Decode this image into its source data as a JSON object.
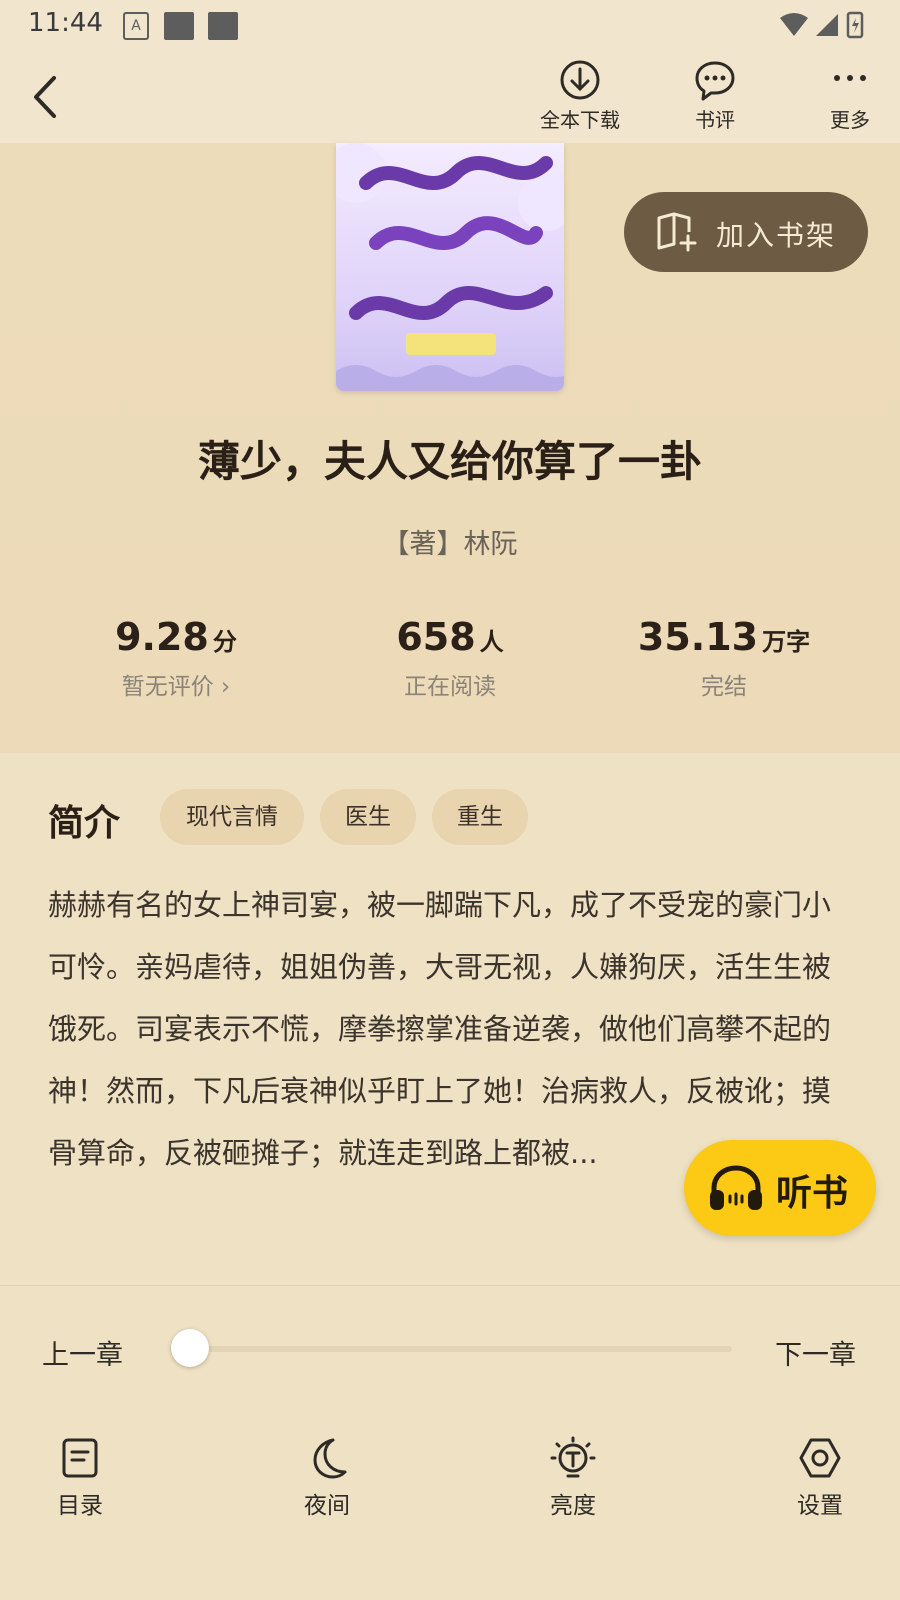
{
  "status_bar": {
    "time": "11:44"
  },
  "toolbar": {
    "download_label": "全本下载",
    "review_label": "书评",
    "more_label": "更多"
  },
  "book": {
    "title": "薄少，夫人又给你算了一卦",
    "author": "【著】林阮",
    "add_shelf_label": "加入书架"
  },
  "stats": {
    "rating": {
      "value": "9.28",
      "unit": "分",
      "sub": "暂无评价"
    },
    "readers": {
      "value": "658",
      "unit": "人",
      "sub": "正在阅读"
    },
    "words": {
      "value": "35.13",
      "unit": "万字",
      "sub": "完结"
    }
  },
  "intro": {
    "heading": "简介",
    "tags": [
      "现代言情",
      "医生",
      "重生"
    ],
    "text": "赫赫有名的女上神司宴，被一脚踹下凡，成了不受宠的豪门小可怜。亲妈虐待，姐姐伪善，大哥无视，人嫌狗厌，活生生被饿死。司宴表示不慌，摩拳擦掌准备逆袭，做他们高攀不起的神！然而，下凡后衰神似乎盯上了她！治病救人，反被讹；摸骨算命，反被砸摊子；就连走到路上都被..."
  },
  "listen_button": {
    "label": "听书"
  },
  "chapter": {
    "prev_label": "上一章",
    "next_label": "下一章",
    "progress": 0
  },
  "bottom_nav": {
    "catalog": "目录",
    "night": "夜间",
    "brightness": "亮度",
    "settings": "设置"
  },
  "colors": {
    "background": "#efe1c3",
    "shelf_button": "#6d5b43",
    "listen_button": "#fcc915",
    "tag_bg": "#e8d4ae"
  }
}
